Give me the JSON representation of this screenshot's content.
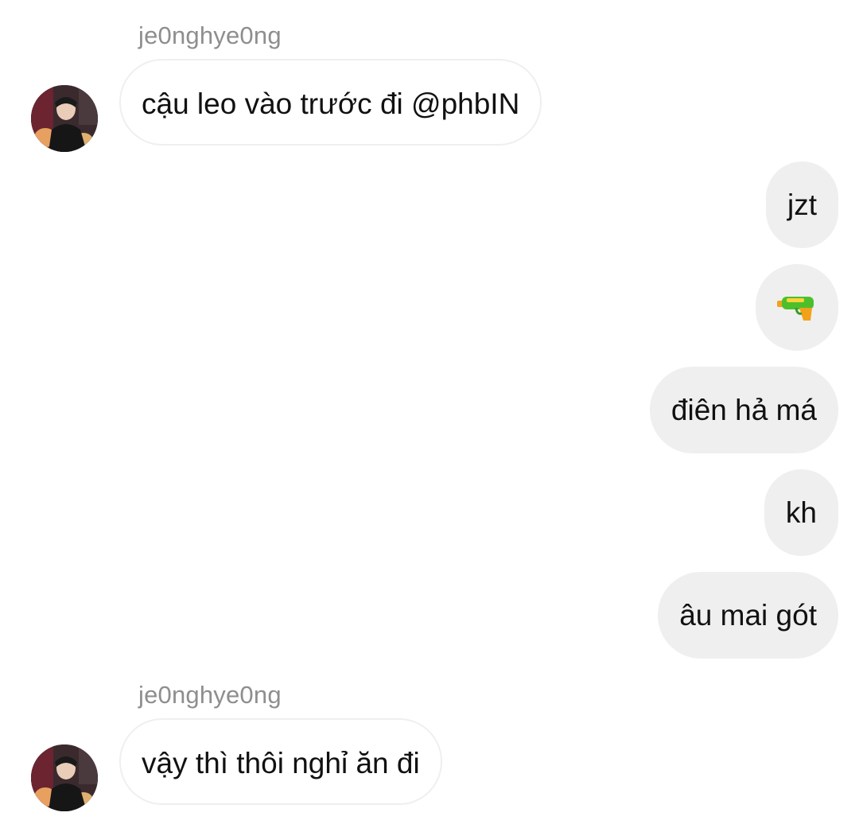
{
  "messages": [
    {
      "sender": "je0nghye0ng",
      "text": "cậu leo vào trước đi @phbIN",
      "direction": "incoming",
      "avatar_icon": "user-avatar"
    },
    {
      "text": "jzt",
      "direction": "outgoing"
    },
    {
      "emoji": "water-pistol",
      "direction": "outgoing"
    },
    {
      "text": "điên hả má",
      "direction": "outgoing"
    },
    {
      "text": "kh",
      "direction": "outgoing"
    },
    {
      "text": "âu mai gót",
      "direction": "outgoing"
    },
    {
      "sender": "je0nghye0ng",
      "text": "vậy thì thôi nghỉ ăn đi",
      "direction": "incoming",
      "avatar_icon": "user-avatar"
    }
  ],
  "colors": {
    "outgoing_bubble": "#efefef",
    "incoming_border": "#efefef",
    "sender_name": "#8e8e8e",
    "text": "#111111"
  }
}
